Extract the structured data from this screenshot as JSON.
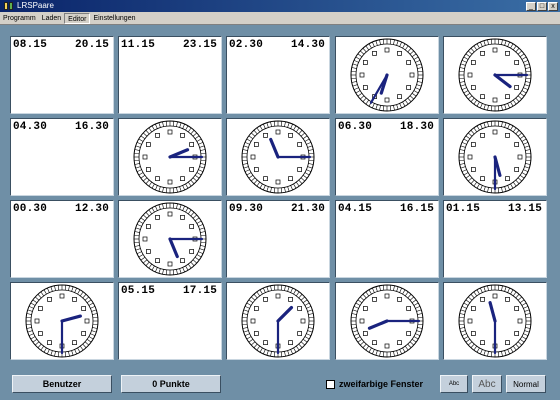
{
  "window": {
    "title": "LRSPaare",
    "controls": [
      "_",
      "□",
      "x"
    ]
  },
  "menu": [
    "Programm",
    "Laden",
    "Editor",
    "Einstellungen"
  ],
  "cards": [
    {
      "type": "text",
      "t1": "08.15",
      "t2": "20.15"
    },
    {
      "type": "text",
      "t1": "11.15",
      "t2": "23.15"
    },
    {
      "type": "text",
      "t1": "02.30",
      "t2": "14.30"
    },
    {
      "type": "clock",
      "h": 6,
      "m": 35
    },
    {
      "type": "clock",
      "h": 4,
      "m": 15
    },
    {
      "type": "text",
      "t1": "04.30",
      "t2": "16.30"
    },
    {
      "type": "clock",
      "h": 2,
      "m": 15
    },
    {
      "type": "clock",
      "h": 11,
      "m": 15
    },
    {
      "type": "text",
      "t1": "06.30",
      "t2": "18.30"
    },
    {
      "type": "clock",
      "h": 5,
      "m": 30
    },
    {
      "type": "text",
      "t1": "00.30",
      "t2": "12.30"
    },
    {
      "type": "clock",
      "h": 5,
      "m": 15
    },
    {
      "type": "text",
      "t1": "09.30",
      "t2": "21.30"
    },
    {
      "type": "text",
      "t1": "04.15",
      "t2": "16.15"
    },
    {
      "type": "text",
      "t1": "01.15",
      "t2": "13.15"
    },
    {
      "type": "clock",
      "h": 2,
      "m": 30
    },
    {
      "type": "text",
      "t1": "05.15",
      "t2": "17.15"
    },
    {
      "type": "clock",
      "h": 1,
      "m": 30
    },
    {
      "type": "clock",
      "h": 8,
      "m": 15
    },
    {
      "type": "clock",
      "h": 11,
      "m": 30
    }
  ],
  "footer": {
    "user_button": "Benutzer",
    "points_button": "0 Punkte",
    "two_color_label": "zweifarbige Fenster",
    "two_color_checked": false,
    "font_small": "Abc",
    "font_large": "Abc",
    "mode_button": "Normal"
  },
  "colors": {
    "hand": "#1a237e",
    "background": "#6f8fa6"
  }
}
